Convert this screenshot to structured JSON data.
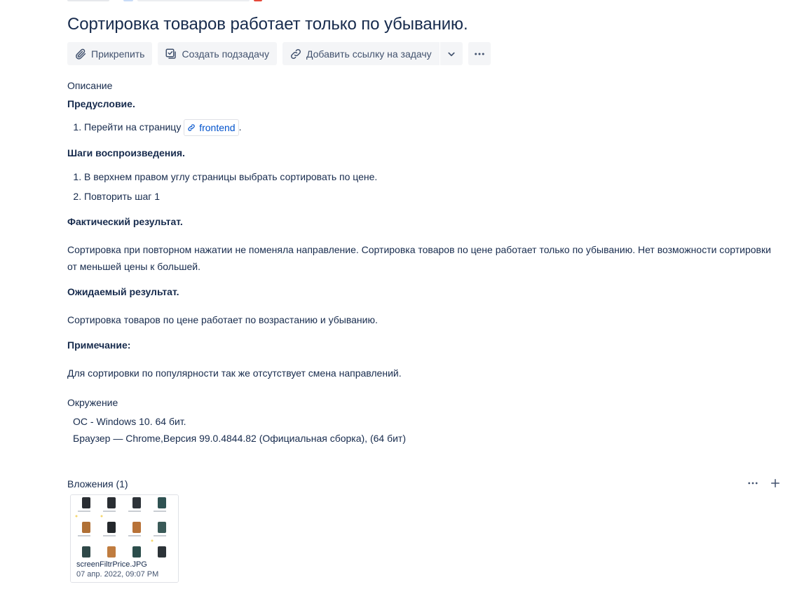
{
  "issue": {
    "title": "Сортировка товаров работает только по убыванию."
  },
  "toolbar": {
    "attach_label": "Прикрепить",
    "subtask_label": "Создать подзадачу",
    "link_issue_label": "Добавить ссылку на задачу"
  },
  "description": {
    "label": "Описание",
    "precondition_heading": "Предусловие.",
    "precondition_step_prefix": "Перейти на страницу",
    "precondition_link": "frontend",
    "precondition_step_suffix": ".",
    "steps_heading": "Шаги воспроизведения.",
    "steps": [
      "В верхнем правом углу страницы выбрать сортировать по цене.",
      "Повторить шаг 1"
    ],
    "actual_heading": "Фактический результат.",
    "actual_text": "Сортировка при повторном нажатии не поменяла направление. Сортировка товаров по цене работает только по убыванию. Нет возможности сортировки от меньшей цены к большей.",
    "expected_heading": "Ожидаемый результат.",
    "expected_text": "Сортировка товаров по цене  работает по возрастанию и убыванию.",
    "note_heading": "Примечание:",
    "note_text": "Для сортировки по популярности так же отсутствует смена направлений."
  },
  "environment": {
    "label": "Окружение",
    "lines": [
      "ОС - Windows 10. 64 бит.",
      "Браузер — Chrome,Версия 99.0.4844.82 (Официальная сборка), (64 бит)"
    ]
  },
  "attachments": {
    "label": "Вложения (1)",
    "items": [
      {
        "filename": "screenFiltrPrice.JPG",
        "date": "07 апр. 2022, 09:07 PM"
      }
    ]
  },
  "colors": {
    "text": "#172b4d",
    "muted": "#42526e",
    "link": "#0052cc",
    "button_bg": "#f4f5f7",
    "border": "#dfe1e6"
  },
  "icons": {
    "attach": "paperclip-icon",
    "subtask": "subtask-icon",
    "link": "link-icon",
    "caret": "chevron-down-icon",
    "more": "more-horizontal-icon",
    "add": "plus-icon"
  }
}
